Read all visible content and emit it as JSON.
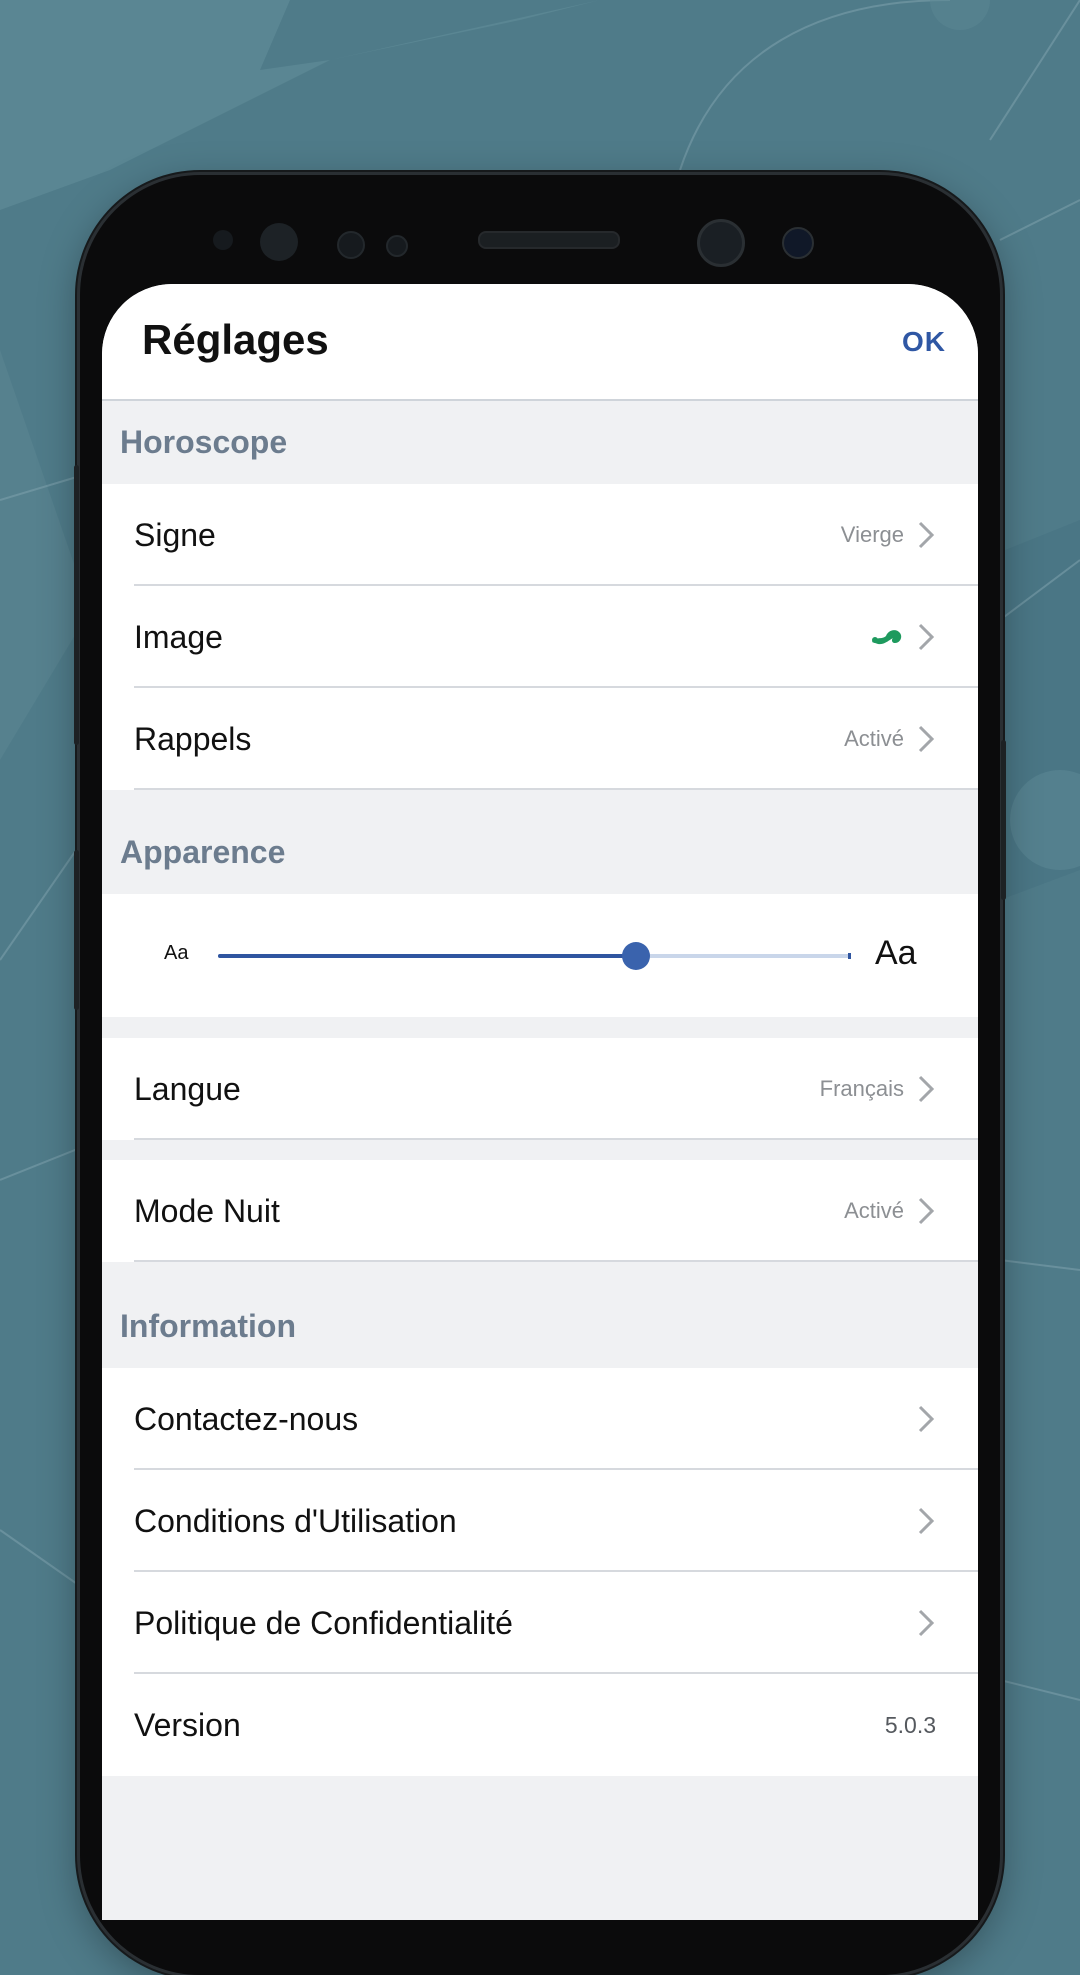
{
  "colors": {
    "background": "#4f7b89",
    "accent": "#2f57a4",
    "section_title": "#6c7c8e",
    "image_icon": "#1e9a5e"
  },
  "header": {
    "title": "Réglages",
    "ok_label": "OK"
  },
  "sections": {
    "horoscope": {
      "title": "Horoscope",
      "items": [
        {
          "label": "Signe",
          "value": "Vierge"
        },
        {
          "label": "Image",
          "value_icon": "green-zodiac-icon"
        },
        {
          "label": "Rappels",
          "value": "Activé"
        }
      ]
    },
    "appearance": {
      "title": "Apparence",
      "slider": {
        "small_label": "Aa",
        "large_label": "Aa",
        "value_percent": 66
      },
      "language": {
        "label": "Langue",
        "value": "Français"
      },
      "night_mode": {
        "label": "Mode Nuit",
        "value": "Activé"
      }
    },
    "information": {
      "title": "Information",
      "items": [
        {
          "label": "Contactez-nous"
        },
        {
          "label": "Conditions d'Utilisation"
        },
        {
          "label": "Politique de Confidentialité"
        },
        {
          "label": "Version",
          "value": "5.0.3"
        }
      ]
    }
  },
  "icons": {
    "chevron": "chevron-right-icon"
  }
}
